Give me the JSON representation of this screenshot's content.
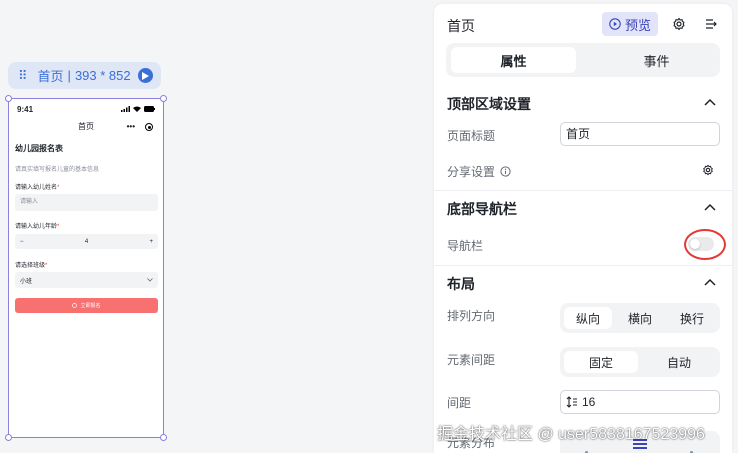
{
  "page_label": {
    "name": "首页",
    "separator": "|",
    "size": "393 * 852"
  },
  "phone": {
    "time": "9:41",
    "nav_title": "首页",
    "nav_more": "•••",
    "form_title": "幼儿园报名表",
    "form_subtitle": "请真实填写报名儿童的基本信息",
    "name_label": "请输入幼儿姓名",
    "required_mark": "*",
    "name_placeholder": "请输入",
    "age_label": "请输入幼儿年龄",
    "age_minus": "−",
    "age_value": "4",
    "age_plus": "+",
    "class_label": "请选择班级",
    "class_value": "小班",
    "submit_label": "立即报名"
  },
  "panel": {
    "title": "首页",
    "preview_label": "预览",
    "tabs": [
      {
        "label": "属性",
        "active": true
      },
      {
        "label": "事件",
        "active": false
      }
    ],
    "sections": {
      "top": {
        "title": "顶部区域设置",
        "page_title_label": "页面标题",
        "page_title_value": "首页",
        "share_label": "分享设置"
      },
      "bottom": {
        "title": "底部导航栏",
        "nav_label": "导航栏",
        "nav_enabled": false
      },
      "layout": {
        "title": "布局",
        "direction_label": "排列方向",
        "direction_options": [
          "纵向",
          "横向",
          "换行"
        ],
        "direction_selected": "纵向",
        "spacing_label": "元素间距",
        "spacing_options": [
          "固定",
          "自动"
        ],
        "spacing_selected": "固定",
        "gap_label": "间距",
        "gap_value": "16",
        "distribution_label": "元素分布"
      }
    }
  },
  "watermark": "掘金技术社区 @ user5838167523996",
  "colors": {
    "accent": "#3b6fd6",
    "selection": "#8b7fe0",
    "submit": "#f87171",
    "annotation": "#e53935"
  }
}
